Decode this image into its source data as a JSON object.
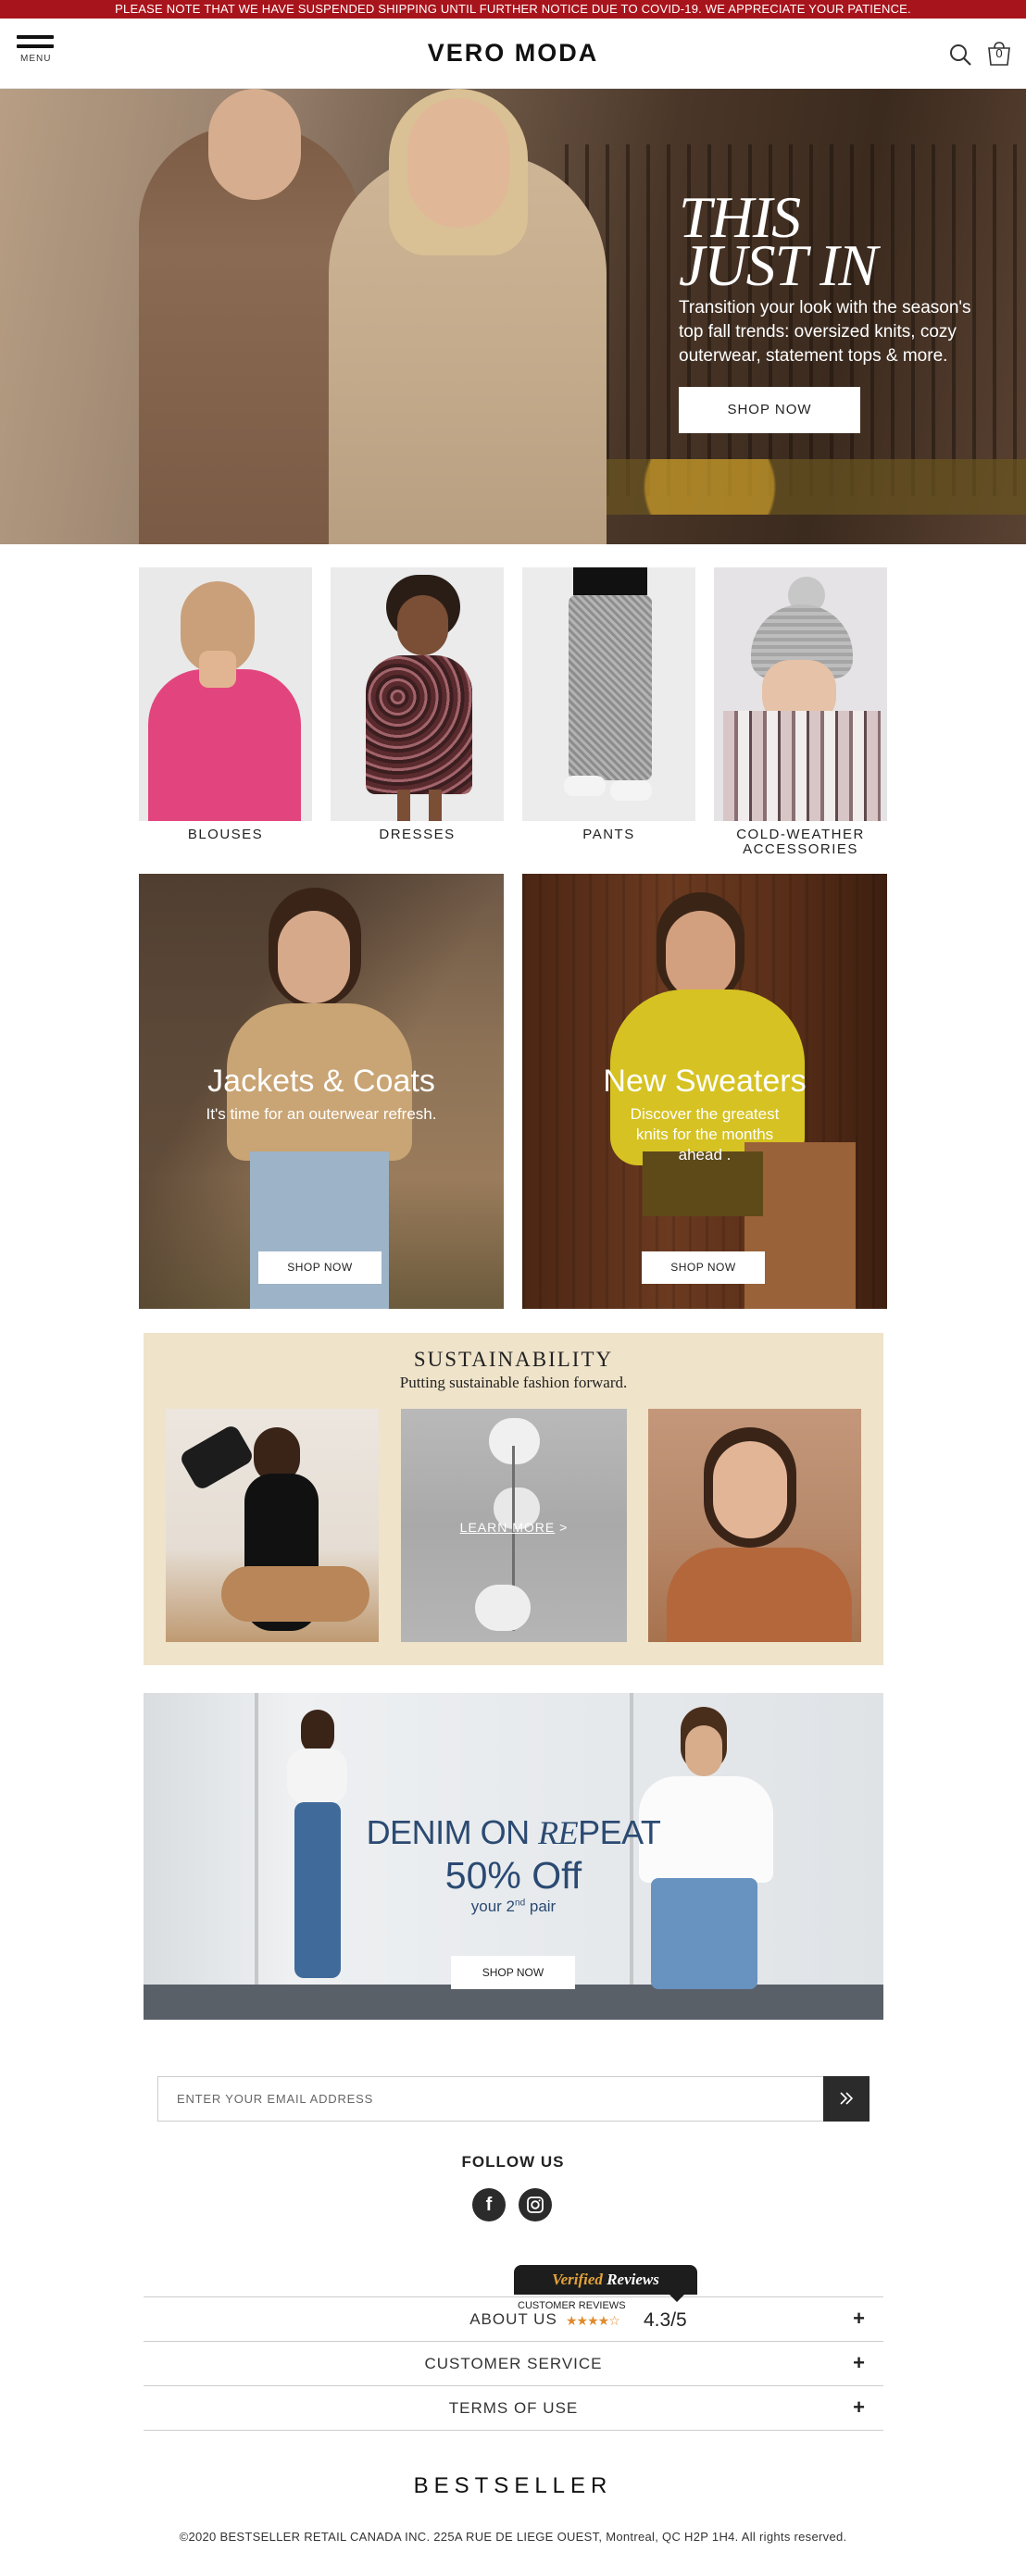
{
  "notice": "PLEASE NOTE THAT WE HAVE SUSPENDED SHIPPING UNTIL FURTHER NOTICE DUE TO COVID-19. WE APPRECIATE YOUR PATIENCE.",
  "header": {
    "menu_label": "MENU",
    "logo": "VERO MODA",
    "cart_count": "0",
    "icons": [
      "hamburger-icon",
      "search-icon",
      "shopping-bag-icon"
    ]
  },
  "hero": {
    "title_line1": "THIS",
    "title_line2": "JUST IN",
    "text": "Transition your look with the season's top fall trends: oversized knits, cozy outerwear, statement tops & more.",
    "button": "SHOP NOW"
  },
  "categories": [
    {
      "label": "BLOUSES"
    },
    {
      "label": "DRESSES"
    },
    {
      "label": "PANTS"
    },
    {
      "label": "COLD-WEATHER ACCESSORIES"
    }
  ],
  "promos": [
    {
      "title": "Jackets & Coats",
      "subtitle": "It's time for an outerwear refresh.",
      "button": "SHOP NOW"
    },
    {
      "title": "New Sweaters",
      "subtitle": "Discover the greatest knits for the months ahead .",
      "button": "SHOP NOW"
    }
  ],
  "sustainability": {
    "title": "SUSTAINABILITY",
    "subtitle": "Putting sustainable fashion forward.",
    "link": "LEARN MORE",
    "link_arrow": ">"
  },
  "denim": {
    "title_a": "DENIM ON ",
    "title_b": "RE",
    "title_c": "PEAT",
    "offer": "50% Off",
    "pair_a": "your 2",
    "pair_sup": "nd",
    "pair_b": " pair",
    "button": "SHOP NOW"
  },
  "newsletter": {
    "placeholder": "ENTER YOUR EMAIL ADDRESS",
    "submit_icon": "double-chevron-right-icon"
  },
  "follow": {
    "label": "FOLLOW US",
    "facebook": "f",
    "instagram": "instagram-icon"
  },
  "accordion": [
    {
      "label": "ABOUT US",
      "toggle": "+"
    },
    {
      "label": "CUSTOMER SERVICE",
      "toggle": "+"
    },
    {
      "label": "TERMS OF USE",
      "toggle": "+"
    }
  ],
  "reviews": {
    "brand_a": "Verified",
    "brand_b": " Reviews",
    "caption": "CUSTOMER REVIEWS",
    "stars": 4.3,
    "rating": "4.3/5"
  },
  "footer": {
    "brand": "BESTSELLER",
    "copyright": "©2020 BESTSELLER RETAIL CANADA INC. 225A RUE DE LIEGE OUEST, Montreal, QC H2P 1H4. All rights reserved."
  },
  "colors": {
    "notice_bg": "#a8141c",
    "denim_text": "#2b4a72",
    "sustain_bg": "#efe3ca",
    "reviews_accent": "#e3a23a"
  }
}
